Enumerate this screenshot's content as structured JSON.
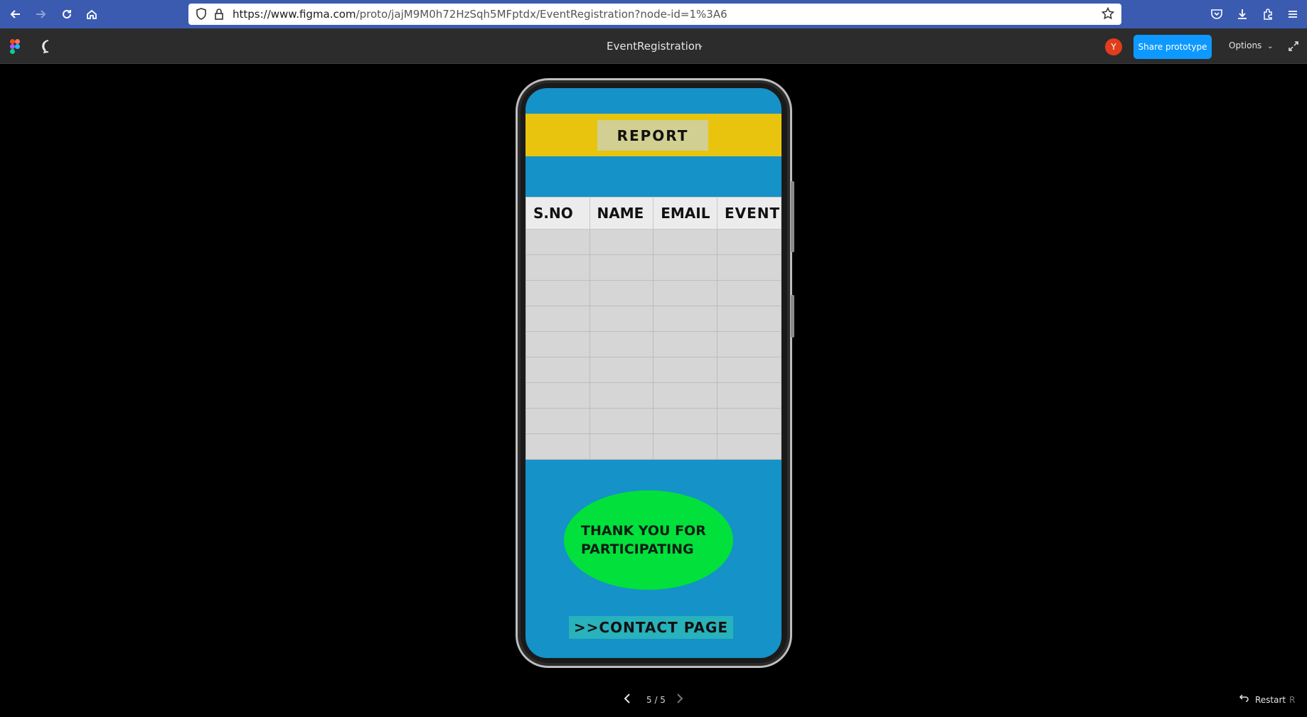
{
  "browser": {
    "url_host": "https://www.figma.com",
    "url_path": "/proto/jajM9M0h72HzSqh5MFptdx/EventRegistration?node-id=1%3A6"
  },
  "figma": {
    "file_title": "EventRegistration",
    "avatar_initial": "Y",
    "share_label": "Share prototype",
    "options_label": "Options",
    "page_counter": "5 / 5",
    "restart_label": "Restart",
    "restart_shortcut": "R"
  },
  "screen": {
    "report_label": "REPORT",
    "table_headers": [
      "S.NO",
      "NAME",
      "EMAIL",
      "EVENT"
    ],
    "thanks_line1": "THANK YOU FOR",
    "thanks_line2": "PARTICIPATING",
    "contact_label": ">>CONTACT PAGE"
  },
  "colors": {
    "screen_bg": "#1592c8",
    "report_band": "#e8c40f",
    "thanks_bg": "#02e03c",
    "contact_bg": "#28b2bc",
    "share_btn": "#0d99ff"
  }
}
